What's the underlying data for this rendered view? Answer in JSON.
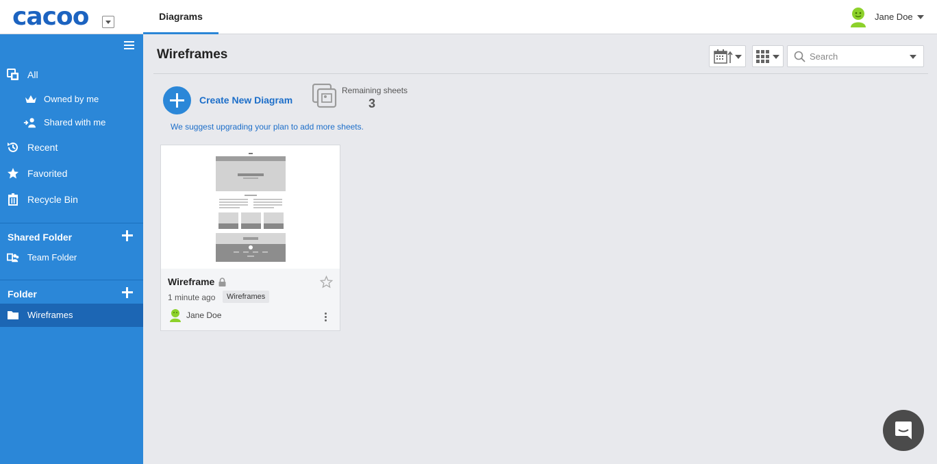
{
  "app": {
    "logo": "cacoo"
  },
  "top": {
    "tab": "Diagrams",
    "user_name": "Jane Doe"
  },
  "sidebar": {
    "items": [
      {
        "label": "All",
        "icon": "copy-icon"
      },
      {
        "label": "Owned by me",
        "icon": "crown-icon"
      },
      {
        "label": "Shared with me",
        "icon": "share-user-icon"
      },
      {
        "label": "Recent",
        "icon": "history-icon"
      },
      {
        "label": "Favorited",
        "icon": "star-icon"
      },
      {
        "label": "Recycle Bin",
        "icon": "trash-icon"
      }
    ],
    "shared_folder": {
      "title": "Shared Folder",
      "items": [
        {
          "label": "Team Folder",
          "icon": "team-icon"
        }
      ]
    },
    "folder": {
      "title": "Folder",
      "items": [
        {
          "label": "Wireframes",
          "icon": "folder-icon",
          "active": true
        }
      ]
    }
  },
  "main": {
    "title": "Wireframes",
    "search_placeholder": "Search",
    "create_label": "Create New Diagram",
    "remaining_label": "Remaining sheets",
    "remaining_count": "3",
    "upgrade_text": "We suggest upgrading your plan to add more sheets."
  },
  "cards": [
    {
      "name": "Wireframe",
      "time": "1 minute ago",
      "tag": "Wireframes",
      "owner": "Jane Doe",
      "locked": true,
      "favorited": false
    }
  ],
  "colors": {
    "sidebar": "#2b87d8",
    "sidebar_active": "#1c66b4",
    "accent": "#1c6ec9",
    "avatar": "#8dd12b"
  }
}
